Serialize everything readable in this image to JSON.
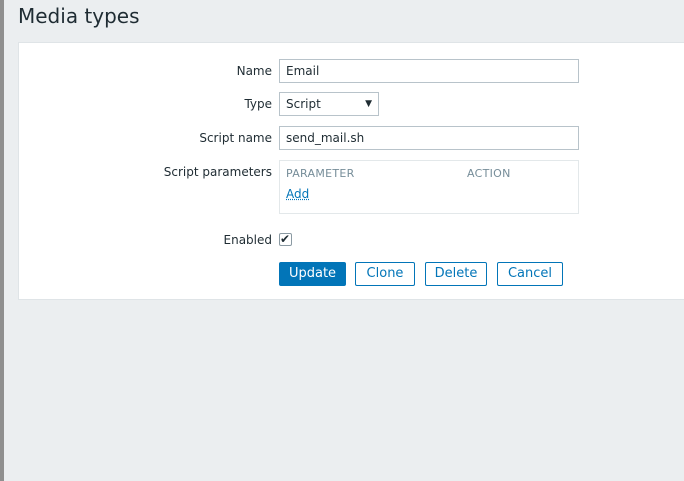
{
  "page": {
    "title": "Media types"
  },
  "form": {
    "name": {
      "label": "Name",
      "value": "Email"
    },
    "type": {
      "label": "Type",
      "value": "Script"
    },
    "script_name": {
      "label": "Script name",
      "value": "send_mail.sh"
    },
    "script_parameters": {
      "label": "Script parameters",
      "col_parameter": "PARAMETER",
      "col_action": "ACTION",
      "add_label": "Add"
    },
    "enabled": {
      "label": "Enabled",
      "checked": true
    }
  },
  "buttons": {
    "update": "Update",
    "clone": "Clone",
    "delete": "Delete",
    "cancel": "Cancel"
  },
  "colors": {
    "accent": "#0275b8",
    "background": "#ebeef0"
  }
}
